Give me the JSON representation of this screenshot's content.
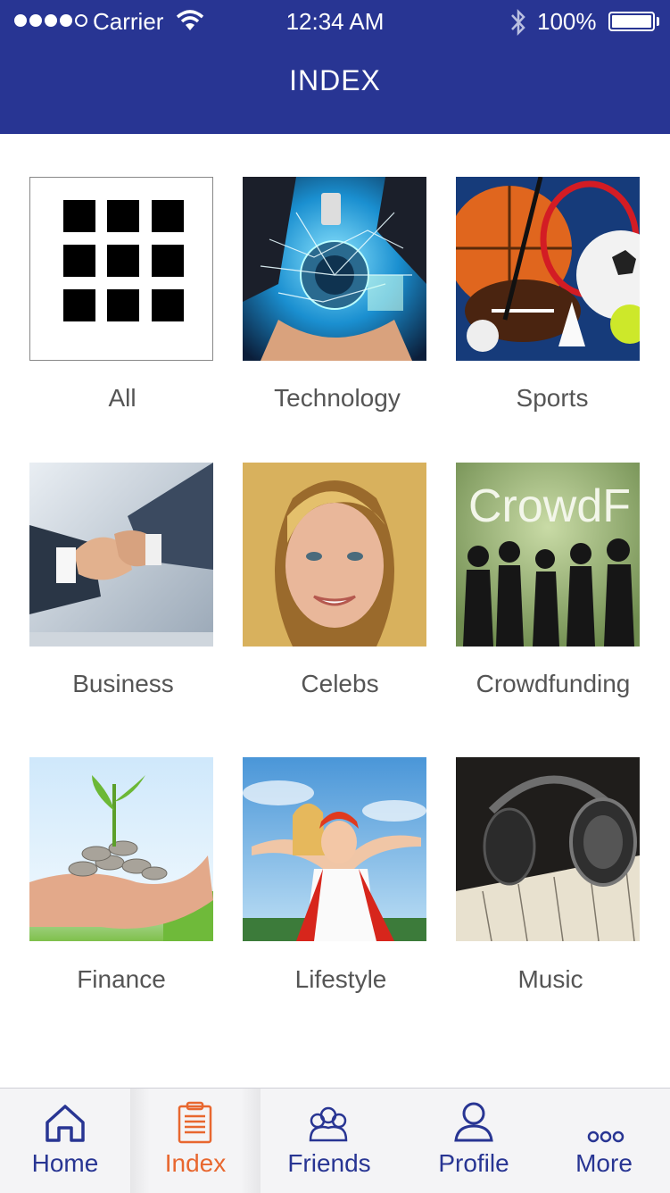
{
  "status_bar": {
    "carrier": "Carrier",
    "time": "12:34 AM",
    "battery": "100%"
  },
  "header": {
    "title": "INDEX"
  },
  "categories": [
    {
      "label": "All",
      "icon": "grid-icon"
    },
    {
      "label": "Technology"
    },
    {
      "label": "Sports"
    },
    {
      "label": "Business"
    },
    {
      "label": "Celebs"
    },
    {
      "label": "Crowdfunding",
      "image_text": "CrowdF"
    },
    {
      "label": "Finance"
    },
    {
      "label": "Lifestyle"
    },
    {
      "label": "Music"
    }
  ],
  "tab_bar": {
    "tabs": [
      {
        "label": "Home",
        "icon": "home-icon"
      },
      {
        "label": "Index",
        "icon": "clipboard-icon",
        "active": true
      },
      {
        "label": "Friends",
        "icon": "friends-icon"
      },
      {
        "label": "Profile",
        "icon": "profile-icon"
      },
      {
        "label": "More",
        "icon": "more-icon"
      }
    ]
  },
  "colors": {
    "brand": "#283593",
    "active_tab": "#e8672f"
  }
}
